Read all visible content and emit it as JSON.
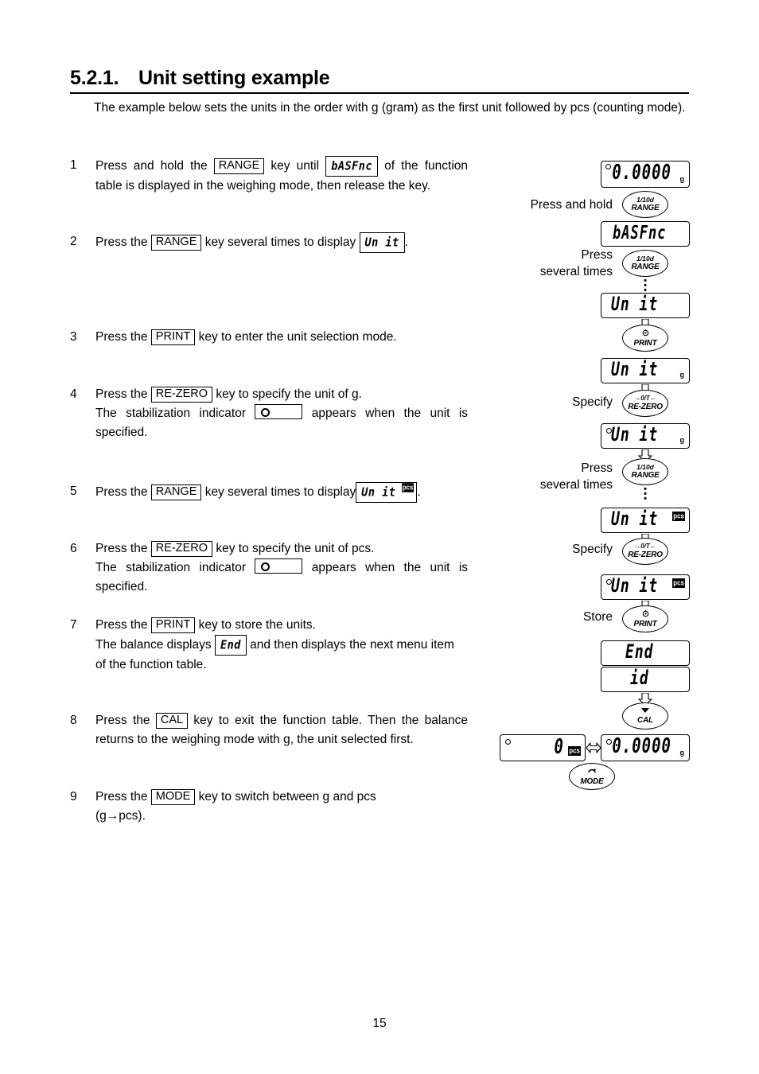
{
  "heading": {
    "number": "5.2.1.",
    "title": "Unit setting example"
  },
  "intro": "The example below sets the units in the order with g (gram) as the first unit followed by pcs (counting mode).",
  "steps": [
    {
      "num": "1",
      "text_1": "Press and hold the",
      "key_1": "RANGE",
      "text_2": "key until",
      "lcd_1": "bASFnc",
      "text_3": "of the function table is displayed in the weighing mode, then release the key."
    },
    {
      "num": "2",
      "text_1": "Press the",
      "key_1": "RANGE",
      "text_2": "key several times to display",
      "lcd_1": "Un it",
      "text_3": "."
    },
    {
      "num": "3",
      "text_1": "Press the",
      "key_1": "PRINT",
      "text_2": "key to enter the unit selection mode."
    },
    {
      "num": "4",
      "text_1": "Press the",
      "key_1": "RE-ZERO",
      "text_2": "key to specify the unit of g.",
      "text_3": "The stabilization indicator",
      "indicator": "stabilization-indicator",
      "text_4": "appears when the unit is specified."
    },
    {
      "num": "5",
      "text_1": "Press the",
      "key_1": "RANGE",
      "text_2": "key several times to display",
      "lcd_1": "Un it",
      "lcd_1_mark": "pcs",
      "text_3": "."
    },
    {
      "num": "6",
      "text_1": "Press the",
      "key_1": "RE-ZERO",
      "text_2": "key to specify the unit of pcs.",
      "text_3": "The stabilization indicator",
      "indicator": "stabilization-indicator",
      "text_4": "appears when the unit is specified."
    },
    {
      "num": "7",
      "text_1": "Press the",
      "key_1": "PRINT",
      "text_2": "key to store the units.",
      "text_3": "The balance displays",
      "lcd_1": "End",
      "text_4": "and then displays the next menu item of the function table."
    },
    {
      "num": "8",
      "text_1": "Press the",
      "key_1": "CAL",
      "text_2": "key to exit the function table. Then the balance returns to the weighing mode with g, the unit selected first."
    },
    {
      "num": "9",
      "text_1": "Press the",
      "key_1": "MODE",
      "text_2": "key to switch between g and pcs",
      "text_3": "(g→pcs)."
    }
  ],
  "diagram": {
    "displays": {
      "d1": {
        "value": "0.0000",
        "unit": "g",
        "stab": "on"
      },
      "d2": {
        "value": "bASFnc"
      },
      "d3": {
        "value": "Un it"
      },
      "d4": {
        "value": "Un it",
        "unit": "g"
      },
      "d5": {
        "value": "Un it",
        "unit": "g",
        "stab": "on"
      },
      "d6": {
        "value": "Un it",
        "pcs": "pcs"
      },
      "d7": {
        "value": "Un it",
        "pcs": "pcs",
        "stab": "on"
      },
      "d8": {
        "value": "End"
      },
      "d9": {
        "value": "id"
      },
      "d10": {
        "value": "0",
        "pcs": "pcs",
        "stab": "on"
      },
      "d11": {
        "value": "0.0000",
        "unit": "g",
        "stab": "on"
      }
    },
    "keys": {
      "k1": {
        "top": "1/10d",
        "name": "RANGE"
      },
      "k2": {
        "top": "1/10d",
        "name": "RANGE"
      },
      "k3": {
        "icon": "print-icon",
        "name": "PRINT"
      },
      "k4": {
        "icon": "re-zero-icon",
        "top": "→0/T←",
        "name": "RE-ZERO"
      },
      "k5": {
        "top": "1/10d",
        "name": "RANGE"
      },
      "k6": {
        "icon": "re-zero-icon",
        "top": "→0/T←",
        "name": "RE-ZERO"
      },
      "k7": {
        "icon": "print-icon",
        "name": "PRINT"
      },
      "k8": {
        "icon": "cal-icon",
        "name": "CAL"
      },
      "k9": {
        "icon": "mode-icon",
        "name": "MODE"
      }
    },
    "labels": {
      "l1": "Press and hold",
      "l2": "Press\nseveral times",
      "l3": "Specify",
      "l4": "Press\nseveral times",
      "l5": "Specify",
      "l6": "Store"
    }
  },
  "page_number": "15"
}
